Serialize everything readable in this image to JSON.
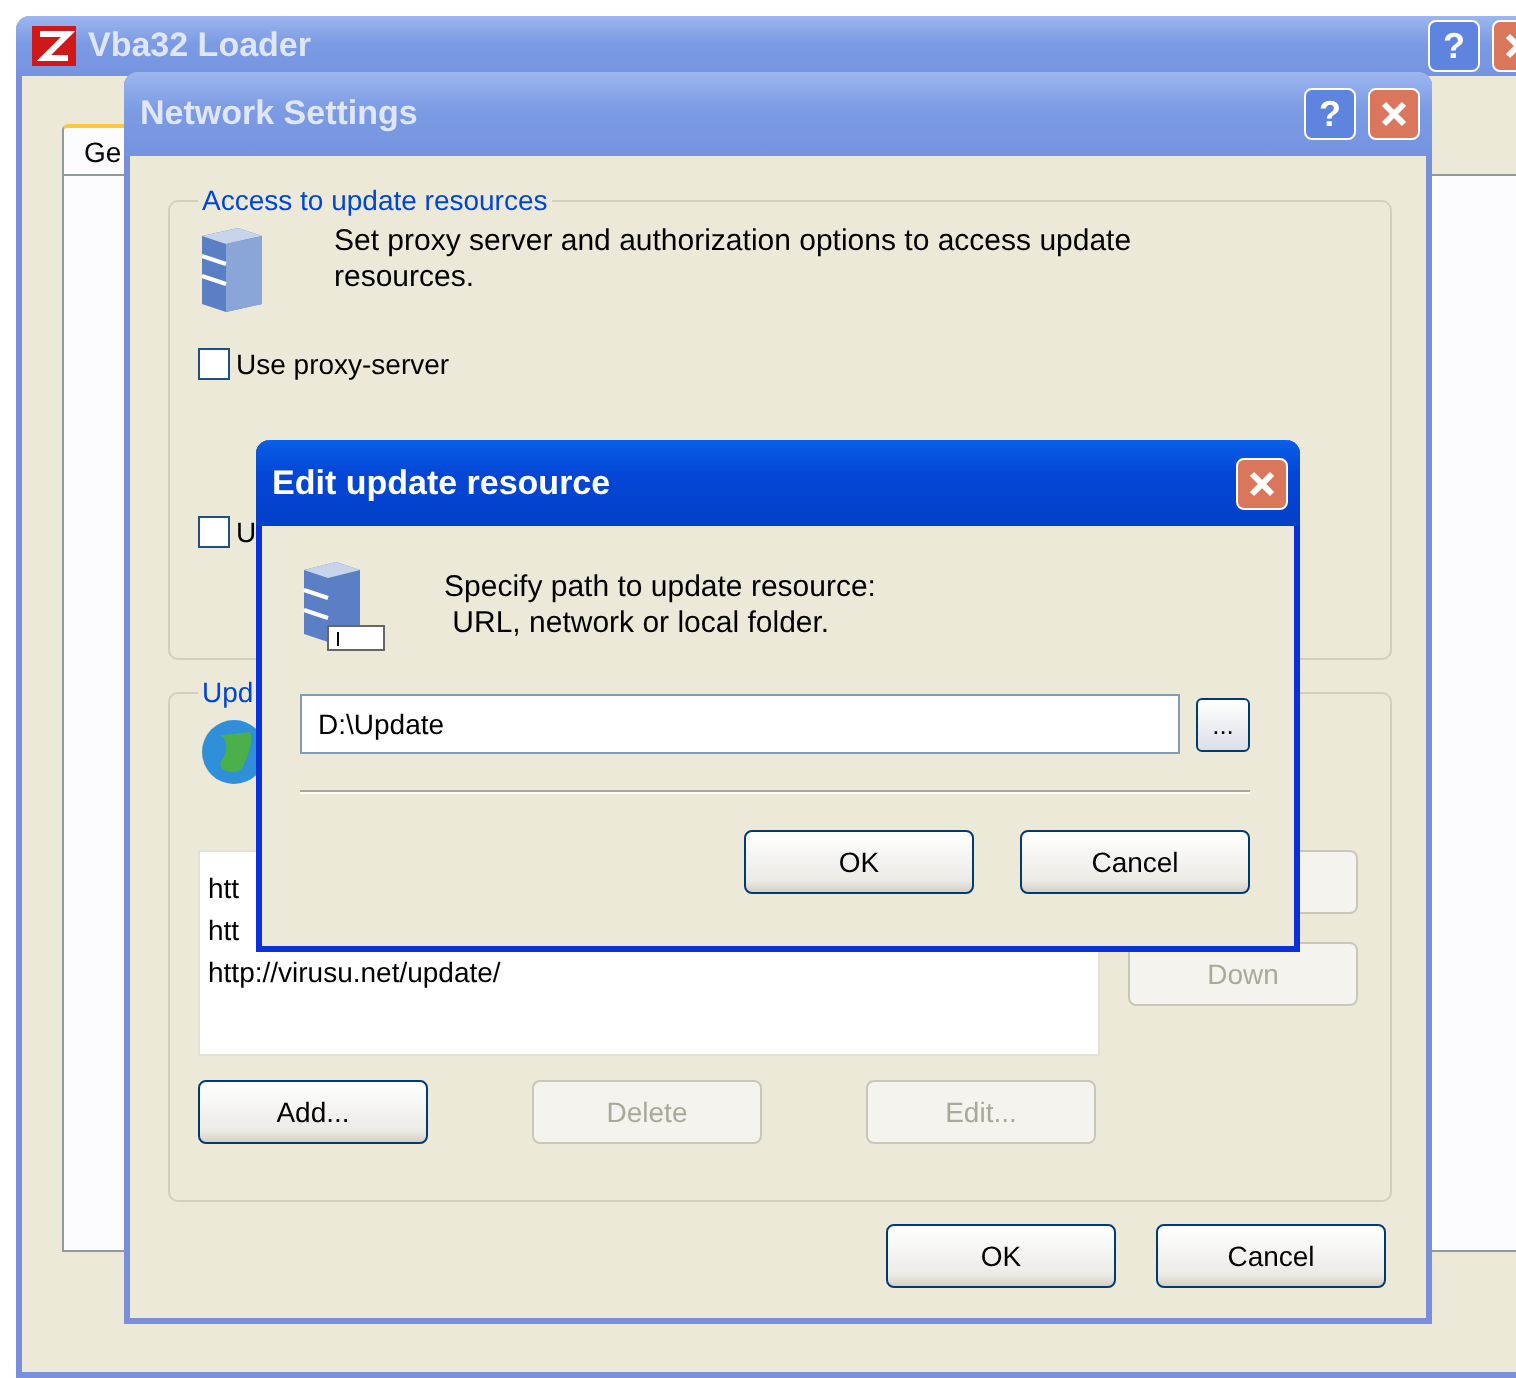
{
  "main_window": {
    "title": "Vba32 Loader",
    "help": "?",
    "tabs": [
      {
        "label": "Ge",
        "selected": true
      }
    ]
  },
  "network_settings": {
    "title": "Network Settings",
    "help": "?",
    "access_group": {
      "legend": "Access to update resources",
      "description": "Set proxy server and authorization options to access update resources.",
      "options": [
        {
          "label": "Use proxy-server",
          "checked": false
        },
        {
          "label": "U",
          "checked": false
        }
      ]
    },
    "update_group": {
      "legend": "Upd",
      "resources": [
        {
          "text": "htt",
          "selected": false
        },
        {
          "text": "htt",
          "selected": false
        },
        {
          "text": "http://virusu.net/update/",
          "selected": false
        }
      ],
      "side_buttons": [
        {
          "label": "Down",
          "disabled": true
        }
      ],
      "list_buttons": [
        {
          "label": "Add...",
          "disabled": false
        },
        {
          "label": "Delete",
          "disabled": true
        },
        {
          "label": "Edit...",
          "disabled": true
        }
      ]
    },
    "buttons": [
      "OK",
      "Cancel"
    ]
  },
  "edit_dialog": {
    "title": "Edit update resource",
    "description": "Specify path to update resource:\n URL, network or local folder.",
    "path_value": "D:\\Update",
    "browse_label": "...",
    "buttons": [
      "OK",
      "Cancel"
    ]
  }
}
